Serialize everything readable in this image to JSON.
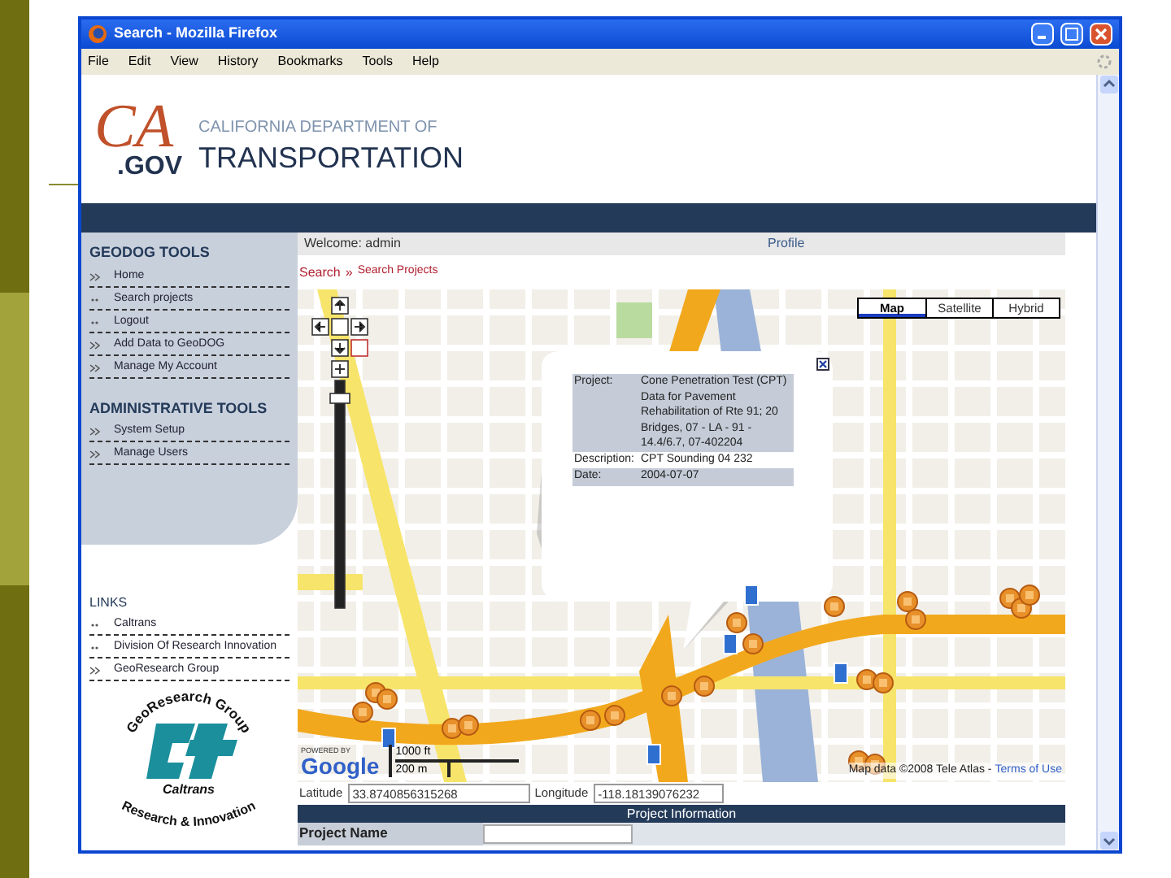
{
  "window": {
    "title": "Search - Mozilla Firefox"
  },
  "menu": [
    "File",
    "Edit",
    "View",
    "History",
    "Bookmarks",
    "Tools",
    "Help"
  ],
  "header": {
    "logo_mark": "CA",
    "logo_suffix": ".GOV",
    "agency_line": "CALIFORNIA DEPARTMENT OF",
    "agency_name": "TRANSPORTATION"
  },
  "nav": {
    "welcome": "Welcome: admin",
    "profile": "Profile"
  },
  "sidebar": {
    "sections": [
      {
        "title": "GEODOG TOOLS",
        "items": [
          {
            "label": "Home",
            "kind": "arrow"
          },
          {
            "label": "Search projects",
            "kind": "dot"
          },
          {
            "label": "Logout",
            "kind": "dot"
          },
          {
            "label": "Add Data to GeoDOG",
            "kind": "arrow"
          },
          {
            "label": "Manage My Account",
            "kind": "arrow"
          }
        ]
      },
      {
        "title": "ADMINISTRATIVE TOOLS",
        "items": [
          {
            "label": "System Setup",
            "kind": "arrow"
          },
          {
            "label": "Manage Users",
            "kind": "arrow"
          }
        ]
      }
    ],
    "links": {
      "title": "LINKS",
      "items": [
        {
          "label": "Caltrans",
          "kind": "dot"
        },
        {
          "label": "Division Of Research Innovation",
          "kind": "dot"
        },
        {
          "label": "GeoResearch Group",
          "kind": "arrow"
        }
      ]
    },
    "emblem": {
      "top": "GeoResearch Group",
      "middle": "Caltrans",
      "bottom": "Research & Innovation"
    }
  },
  "breadcrumb": {
    "current": "Search",
    "separator": "»",
    "link": "Search Projects"
  },
  "map": {
    "types": [
      {
        "label": "Map",
        "selected": true
      },
      {
        "label": "Satellite",
        "selected": false
      },
      {
        "label": "Hybrid",
        "selected": false
      }
    ],
    "popup": {
      "rows": [
        {
          "label": "Project:",
          "value": "Cone Penetration Test (CPT) Data for Pavement Rehabilitation of Rte 91; 20 Bridges, 07 - LA - 91 - 14.4/6.7, 07-402204",
          "shaded": true
        },
        {
          "label": "Description:",
          "value": "CPT Sounding 04 232",
          "shaded": false
        },
        {
          "label": "Date:",
          "value": "2004-07-07",
          "shaded": true
        }
      ]
    },
    "scale": {
      "feet": "1000 ft",
      "meters": "200 m"
    },
    "powered_by": "POWERED BY",
    "google": "Google",
    "attribution": "Map data ©2008 Tele Atlas -",
    "terms": "Terms of Use"
  },
  "coordinates": {
    "latitude_label": "Latitude",
    "latitude": "33.8740856315268",
    "longitude_label": "Longitude",
    "longitude": "-118.18139076232"
  },
  "project_table": {
    "title": "Project Information",
    "rows": [
      {
        "label": "Project Name"
      }
    ]
  }
}
